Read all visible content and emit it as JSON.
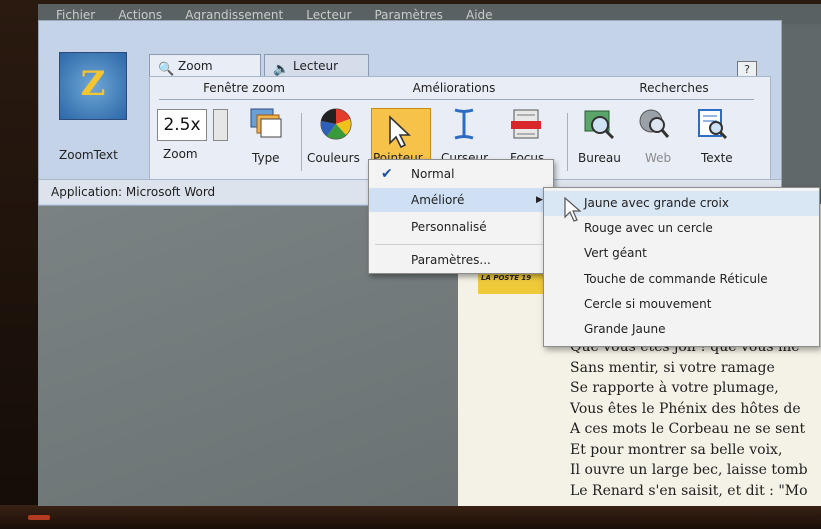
{
  "menubar": [
    "Fichier",
    "Actions",
    "Agrandissement",
    "Lecteur",
    "Paramètres",
    "Aide"
  ],
  "app": {
    "name": "ZoomText",
    "logo": "ZoomText-logo-icon"
  },
  "tabs": [
    {
      "label": "Zoom",
      "icon": "magnifier-icon"
    },
    {
      "label": "Lecteur",
      "icon": "speaker-icon"
    }
  ],
  "help_label": "?",
  "groups": {
    "zoom_window": "Fenêtre zoom",
    "enhancements": "Améliorations",
    "searches": "Recherches"
  },
  "zoom_value": "2.5x",
  "tools": {
    "zoom": "Zoom",
    "type": "Type",
    "colors": "Couleurs",
    "pointer": "Pointeur",
    "cursor": "Curseur",
    "focus": "Focus",
    "desktop": "Bureau",
    "web": "Web",
    "text": "Texte"
  },
  "app_bar": "Application:  Microsoft Word",
  "pointer_menu": [
    {
      "label": "Normal",
      "checked": true
    },
    {
      "label": "Amélioré",
      "submenu": true
    },
    {
      "label": "Personnalisé"
    },
    {
      "label": "Paramètres..."
    }
  ],
  "enhanced_menu": [
    "Jaune avec grande croix",
    "Rouge avec un cercle",
    "Vert géant",
    "Touche de commande Réticule",
    "Cercle si mouvement",
    "Grande Jaune"
  ],
  "document": {
    "logo_text": "LA POSTE 19",
    "lines": [
      "Que vous êtes joli ! que vous me",
      "Sans mentir, si votre ramage",
      "Se rapporte à votre plumage,",
      "Vous êtes le Phénix des hôtes de",
      "A ces mots le Corbeau ne se sent",
      "Et pour montrer sa belle voix,",
      "Il ouvre un large bec, laisse tomb",
      "Le Renard s'en saisit, et dit : \"Mo"
    ]
  },
  "colors": {
    "accent": "#f6c24a",
    "ribbon": "#c5d3e8",
    "panel": "#e9eef6"
  }
}
